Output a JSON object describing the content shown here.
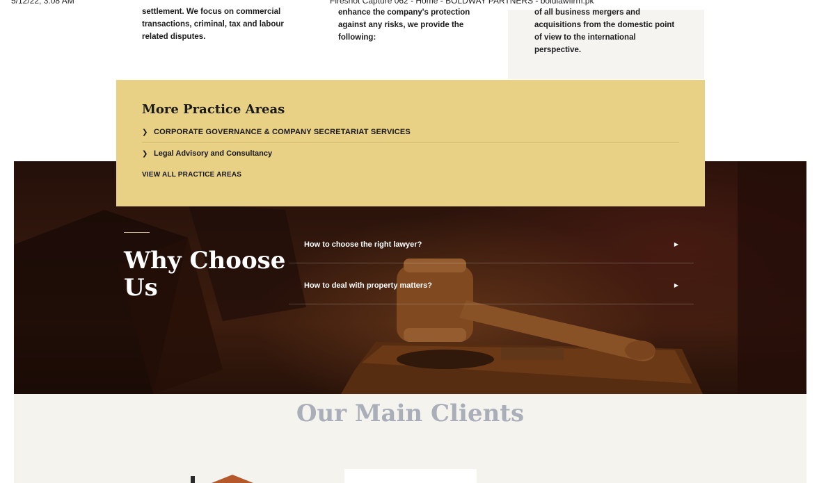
{
  "print_header": {
    "left": "5/12/22, 3:08 AM",
    "center": "Fireshot Capture 062 - Home - BOLDWAY PARTNERS - boldlawfirm.pk"
  },
  "columns": [
    {
      "text": "settlement. We focus on commercial transactions, criminal, tax and labour related disputes."
    },
    {
      "text": "enhance the company's protection against any risks, we provide the following:"
    },
    {
      "text": "of all business mergers and acquisitions from the domestic point of view to the international perspective."
    }
  ],
  "practice": {
    "title": "More Practice Areas",
    "items": [
      {
        "label": "CORPORATE GOVERNANCE & COMPANY SECRETARIAT SERVICES"
      },
      {
        "label": "Legal Advisory and Consultancy"
      }
    ],
    "view_all": "VIEW ALL PRACTICE AREAS",
    "colors": {
      "background": "#e8d184"
    }
  },
  "why": {
    "title": "Why Choose Us",
    "faqs": [
      {
        "question": "How to choose the right lawyer?"
      },
      {
        "question": "How to deal with property matters?"
      }
    ]
  },
  "clients": {
    "title": "Our Main Clients",
    "colors": {
      "title": "#a9aeb9"
    }
  },
  "icons": {
    "chevron": "chevron-right-icon",
    "caret": "caret-right-icon"
  }
}
